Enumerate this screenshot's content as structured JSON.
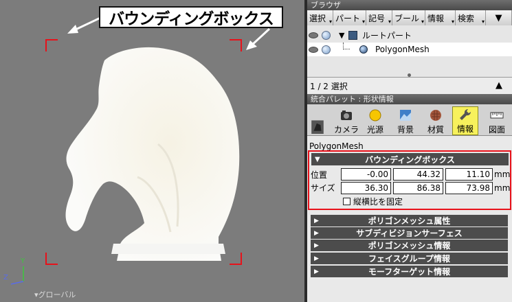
{
  "viewport": {
    "callout_label": "バウンディングボックス",
    "status_label": "▾グローバル",
    "axis_y": "Y",
    "axis_z": "Z",
    "accent_color": "#e8111a"
  },
  "browser": {
    "title": "ブラウザ",
    "toolbar": [
      "選択",
      "パート",
      "記号",
      "ブール",
      "情報",
      "検索"
    ],
    "tree": [
      {
        "label": "ルートパート",
        "icon": "folder-cube-icon",
        "selected": false
      },
      {
        "label": "PolygonMesh",
        "icon": "polygon-mesh-icon",
        "selected": true
      }
    ],
    "selection_count": "1 / 2 選択"
  },
  "palette": {
    "title": "統合パレット : 形状情報",
    "tabs": [
      {
        "label": "",
        "icon": "shape-icon"
      },
      {
        "label": "カメラ",
        "icon": "camera-icon"
      },
      {
        "label": "光源",
        "icon": "light-icon"
      },
      {
        "label": "背景",
        "icon": "background-icon"
      },
      {
        "label": "材質",
        "icon": "material-icon"
      },
      {
        "label": "情報",
        "icon": "wrench-icon",
        "active": true
      },
      {
        "label": "図面",
        "icon": "ruler-icon"
      }
    ],
    "object_name": "PolygonMesh",
    "bounding_box": {
      "header": "バウンディングボックス",
      "position_label": "位置",
      "size_label": "サイズ",
      "position": [
        "-0.00",
        "44.32",
        "11.10"
      ],
      "size": [
        "36.30",
        "86.38",
        "73.98"
      ],
      "unit": "mm",
      "lock_label": "縦横比を固定"
    },
    "sections": [
      "ポリゴンメッシュ属性",
      "サブディビジョンサーフェス",
      "ポリゴンメッシュ情報",
      "フェイスグループ情報",
      "モーフターゲット情報"
    ]
  }
}
